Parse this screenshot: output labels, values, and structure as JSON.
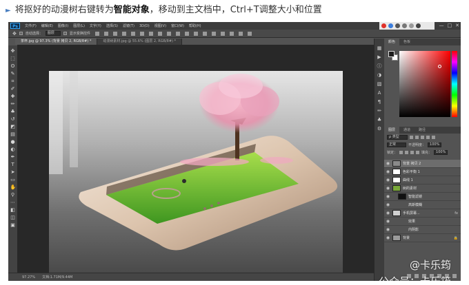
{
  "caption": {
    "arrow": "►",
    "before": "将抠好的动漫树右键转为",
    "strong": "智能对象",
    "after": "，移动到主文档中，Ctrl+T调整大小和位置"
  },
  "app": {
    "logo": "Ps",
    "menu": [
      "文件(F)",
      "编辑(E)",
      "图像(I)",
      "图层(L)",
      "文字(Y)",
      "选择(S)",
      "滤镜(T)",
      "3D(D)",
      "视图(V)",
      "窗口(W)",
      "帮助(H)"
    ],
    "window_controls": [
      "—",
      "□",
      "✕"
    ]
  },
  "options_bar": {
    "auto_select": "自动选择：",
    "auto_select_value": "图层",
    "show_transform": "显示变换控件"
  },
  "tabs": [
    {
      "label": "茶杯.jpg @ 97.3% (背景 拷贝 2, RGB/8#) *",
      "active": true
    },
    {
      "label": "动漫树素材.jpg @ 55.6% (图层 2, RGB/8#) *",
      "active": false
    }
  ],
  "status": {
    "zoom": "97.27%",
    "doc": "文档:1.71M/9.44M"
  },
  "panels": {
    "color_tab": "颜色",
    "swatch_tab": "色板",
    "layers_tab": "图层",
    "channels_tab": "通道",
    "paths_tab": "路径",
    "kind_label": "ρ 类型",
    "blend_mode": "正常",
    "opacity_label": "不透明度：",
    "opacity_value": "100%",
    "lock_label": "锁定：",
    "fill_label": "填充：",
    "fill_value": "100%"
  },
  "layers": [
    {
      "name": "背景 拷贝 2",
      "selected": true,
      "fx": false,
      "thumb": "#8a8a8a"
    },
    {
      "name": "色彩平衡 1",
      "selected": false,
      "fx": false,
      "thumb": "#ffffff"
    },
    {
      "name": "曲线 1",
      "selected": false,
      "fx": false,
      "thumb": "#ffffff"
    },
    {
      "name": "树的素材",
      "selected": false,
      "fx": false,
      "thumb": "#7aa83a"
    },
    {
      "name": "智能滤镜",
      "selected": false,
      "fx": false,
      "thumb": "#111111"
    },
    {
      "name": "高斯模糊",
      "selected": false,
      "fx": false,
      "thumb": "#535353"
    },
    {
      "name": "手机屏幕...",
      "selected": false,
      "fx": true,
      "thumb": "#d0d0d0"
    },
    {
      "name": "效果",
      "selected": false,
      "fx": false,
      "thumb": "#535353"
    },
    {
      "name": "内阴影",
      "selected": false,
      "fx": false,
      "thumb": "#535353"
    },
    {
      "name": "背景",
      "selected": false,
      "fx": false,
      "thumb": "#9a9a9a"
    }
  ],
  "watermark": {
    "line1": "@卡乐筠",
    "line2": "公众号：卡乐筠"
  }
}
